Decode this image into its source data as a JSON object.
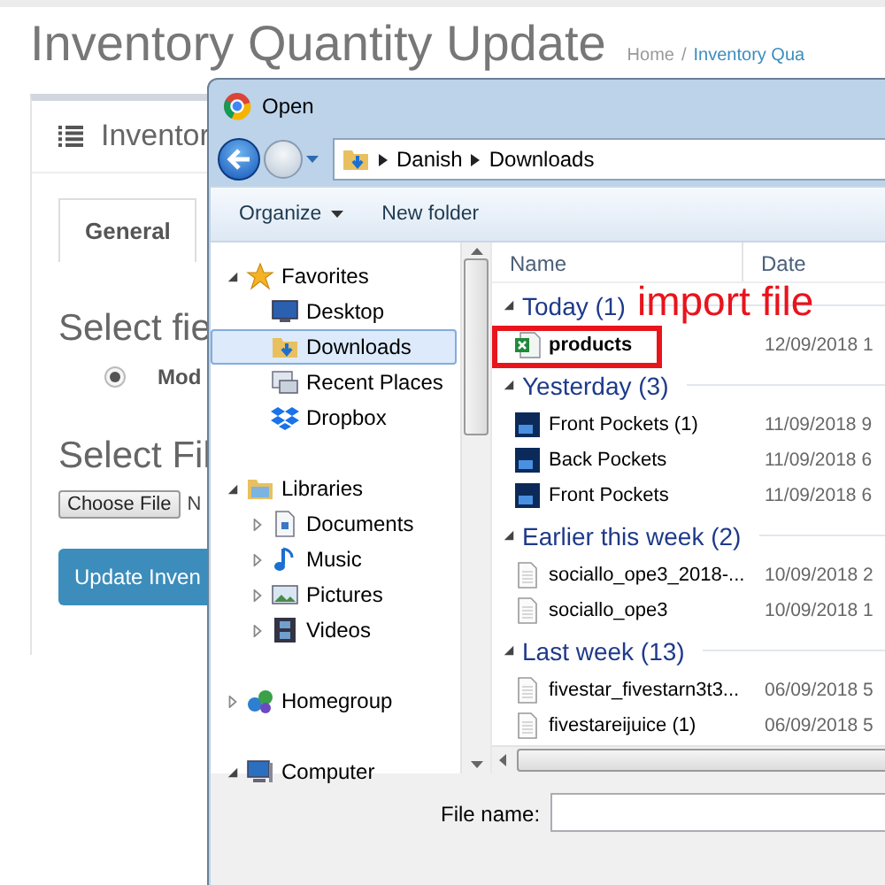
{
  "page": {
    "title": "Inventory Quantity Update",
    "breadcrumb": {
      "home": "Home",
      "separator": "/",
      "current": "Inventory Qua"
    }
  },
  "panel": {
    "title": "Inventor",
    "tabs": [
      {
        "label": "General",
        "selected": true
      }
    ],
    "field_heading": "Select fie",
    "radio": {
      "label": "Mod",
      "selected": true
    },
    "file_heading": "Select Fil",
    "choose_button": "Choose File",
    "file_status": "N",
    "submit": "Update Inven"
  },
  "dialog": {
    "title": "Open",
    "path": [
      "Danish",
      "Downloads"
    ],
    "toolbar": [
      {
        "label": "Organize",
        "dropdown": true
      },
      {
        "label": "New folder",
        "dropdown": false
      }
    ],
    "nav": [
      {
        "label": "Favorites",
        "kind": "star",
        "expanded": true,
        "selected": false,
        "children": [
          {
            "label": "Desktop",
            "kind": "desktop",
            "selected": false
          },
          {
            "label": "Downloads",
            "kind": "downloads",
            "selected": true
          },
          {
            "label": "Recent Places",
            "kind": "recent",
            "selected": false
          },
          {
            "label": "Dropbox",
            "kind": "dropbox",
            "selected": false
          }
        ]
      },
      {
        "label": "Libraries",
        "kind": "library",
        "expanded": true,
        "selected": false,
        "children": [
          {
            "label": "Documents",
            "kind": "documents",
            "expanded": false,
            "selected": false
          },
          {
            "label": "Music",
            "kind": "music",
            "expanded": false,
            "selected": false
          },
          {
            "label": "Pictures",
            "kind": "pictures",
            "expanded": false,
            "selected": false
          },
          {
            "label": "Videos",
            "kind": "videos",
            "expanded": false,
            "selected": false
          }
        ]
      },
      {
        "label": "Homegroup",
        "kind": "homegroup",
        "expanded": false,
        "selected": false
      },
      {
        "label": "Computer",
        "kind": "computer",
        "expanded": true,
        "selected": false
      }
    ],
    "columns": [
      "Name",
      "Date"
    ],
    "groups": [
      {
        "label": "Today (1)",
        "expanded": true,
        "files": [
          {
            "name": "products",
            "date": "12/09/2018 1",
            "kind": "spreadsheet",
            "highlighted": true
          }
        ]
      },
      {
        "label": "Yesterday (3)",
        "expanded": true,
        "files": [
          {
            "name": "Front Pockets (1)",
            "date": "11/09/2018 9",
            "kind": "photoshop",
            "highlighted": false
          },
          {
            "name": "Back Pockets",
            "date": "11/09/2018 6",
            "kind": "photoshop",
            "highlighted": false
          },
          {
            "name": "Front Pockets",
            "date": "11/09/2018 6",
            "kind": "photoshop",
            "highlighted": false
          }
        ]
      },
      {
        "label": "Earlier this week (2)",
        "expanded": true,
        "files": [
          {
            "name": "sociallo_ope3_2018-...",
            "date": "10/09/2018 2",
            "kind": "document",
            "highlighted": false
          },
          {
            "name": "sociallo_ope3",
            "date": "10/09/2018 1",
            "kind": "document",
            "highlighted": false
          }
        ]
      },
      {
        "label": "Last week (13)",
        "expanded": true,
        "files": [
          {
            "name": "fivestar_fivestarn3t3...",
            "date": "06/09/2018 5",
            "kind": "document",
            "highlighted": false
          },
          {
            "name": "fivestareijuice (1)",
            "date": "06/09/2018 5",
            "kind": "document",
            "highlighted": false
          }
        ]
      }
    ],
    "annotation": "import file",
    "file_name_label": "File name:"
  }
}
